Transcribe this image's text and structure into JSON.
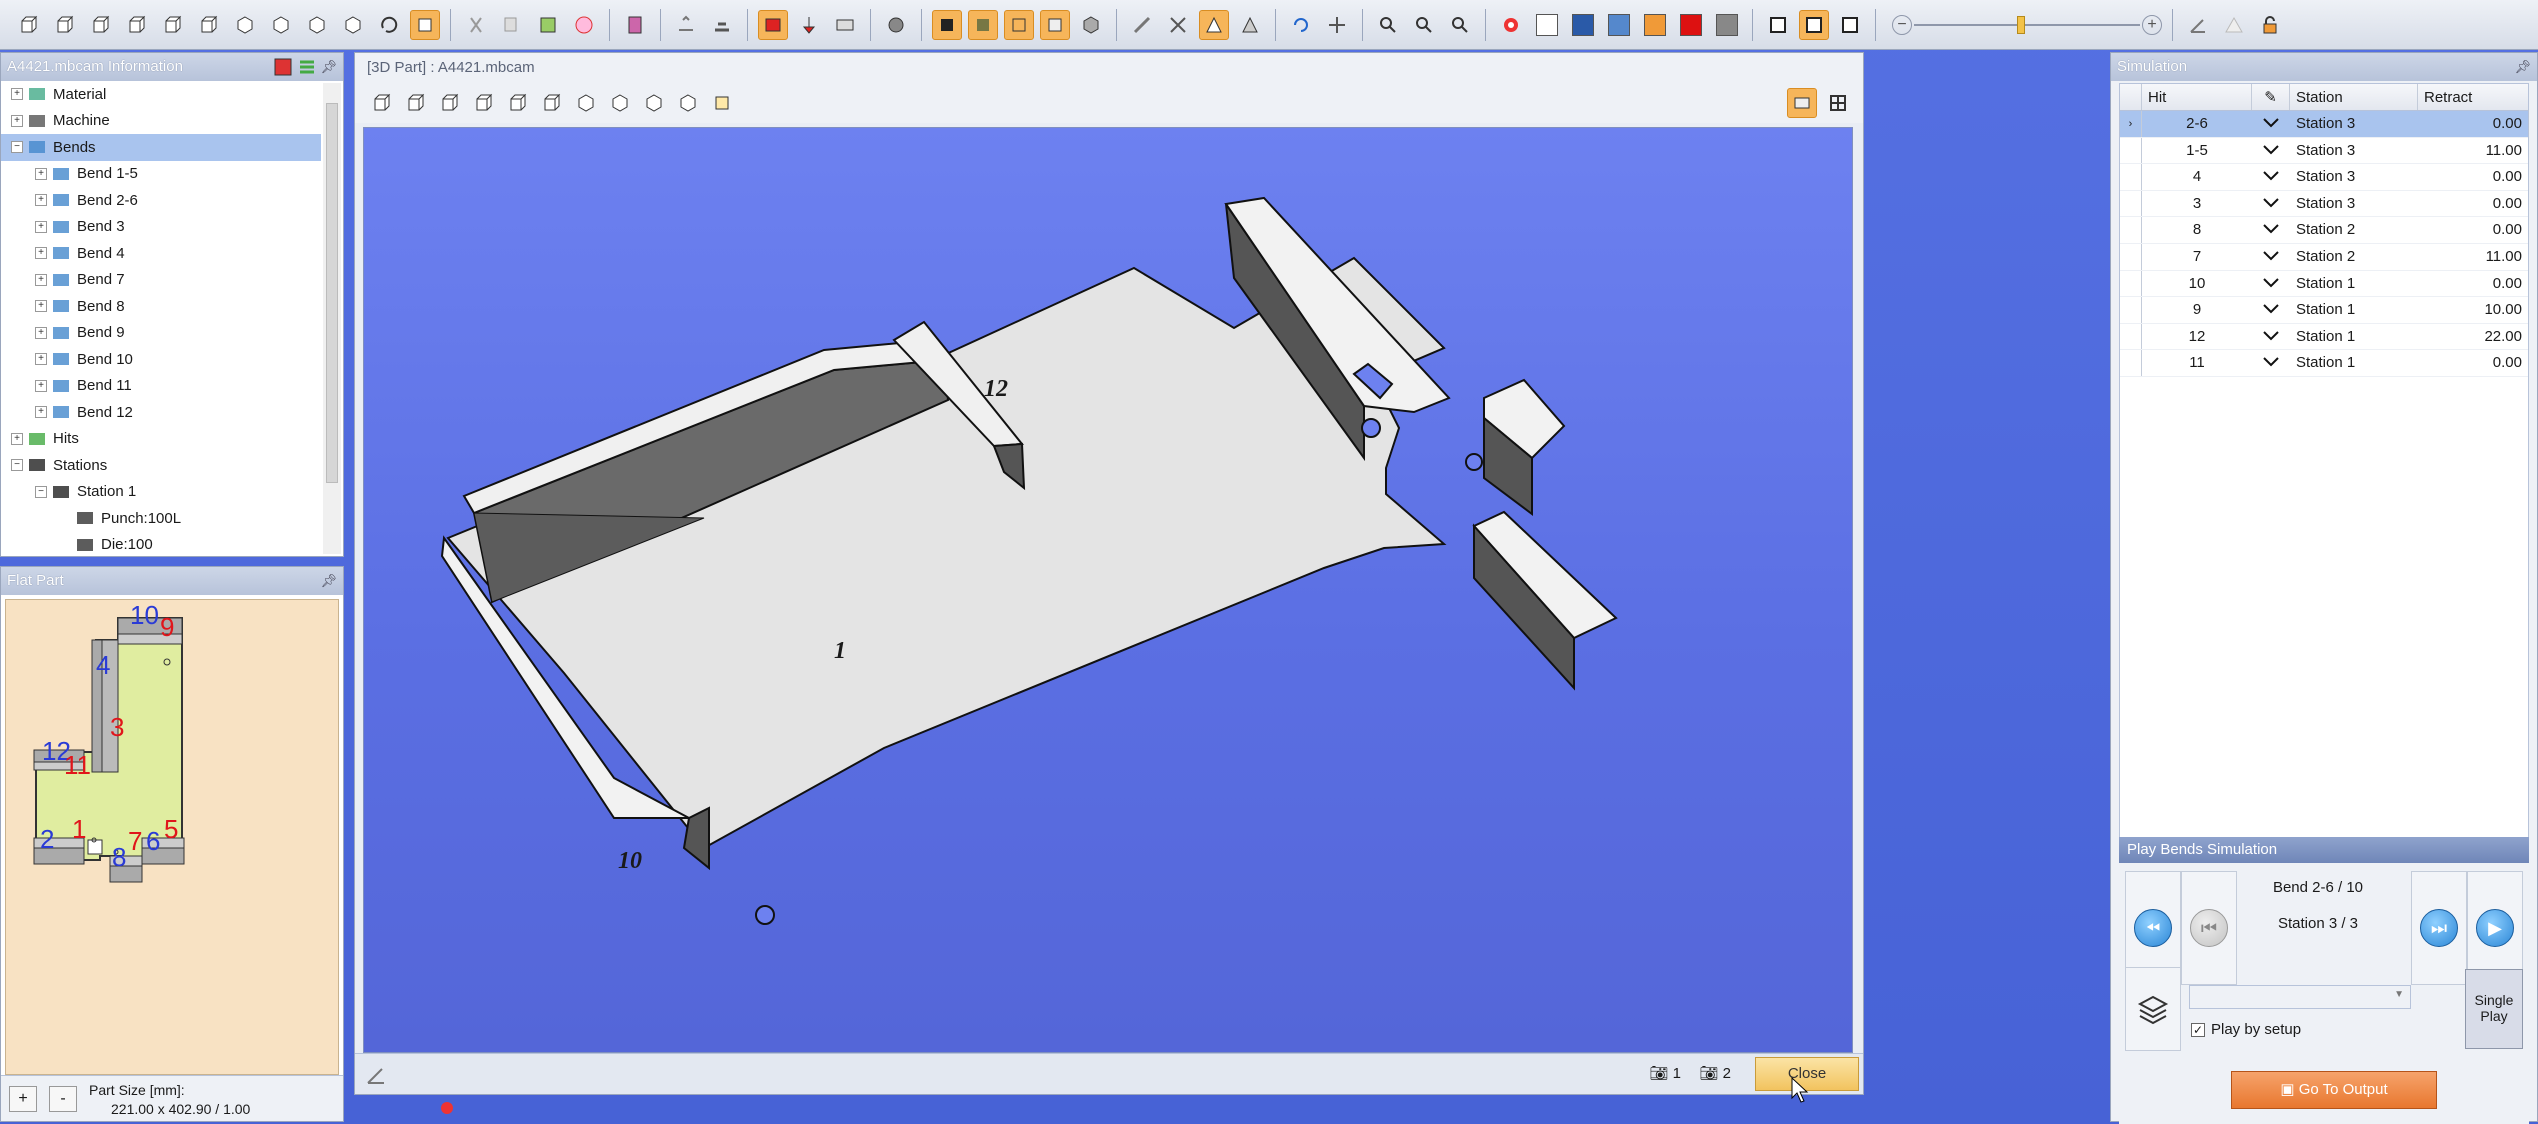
{
  "info_panel": {
    "title": "A4421.mbcam Information",
    "tree": [
      {
        "label": "Material",
        "level": 0,
        "icon": "material-icon",
        "expander": "+"
      },
      {
        "label": "Machine",
        "level": 0,
        "icon": "machine-icon",
        "expander": "+"
      },
      {
        "label": "Bends",
        "level": 0,
        "icon": "bends-icon",
        "expander": "−",
        "selected": true
      },
      {
        "label": "Bend 1-5",
        "level": 1,
        "icon": "bend-icon",
        "expander": "+"
      },
      {
        "label": "Bend 2-6",
        "level": 1,
        "icon": "bend-icon",
        "expander": "+"
      },
      {
        "label": "Bend 3",
        "level": 1,
        "icon": "bend-icon",
        "expander": "+"
      },
      {
        "label": "Bend 4",
        "level": 1,
        "icon": "bend-icon",
        "expander": "+"
      },
      {
        "label": "Bend 7",
        "level": 1,
        "icon": "bend-icon",
        "expander": "+"
      },
      {
        "label": "Bend 8",
        "level": 1,
        "icon": "bend-icon",
        "expander": "+"
      },
      {
        "label": "Bend 9",
        "level": 1,
        "icon": "bend-icon",
        "expander": "+"
      },
      {
        "label": "Bend 10",
        "level": 1,
        "icon": "bend-icon",
        "expander": "+"
      },
      {
        "label": "Bend 11",
        "level": 1,
        "icon": "bend-icon",
        "expander": "+"
      },
      {
        "label": "Bend 12",
        "level": 1,
        "icon": "bend-icon",
        "expander": "+"
      },
      {
        "label": "Hits",
        "level": 0,
        "icon": "hits-icon",
        "expander": "+"
      },
      {
        "label": "Stations",
        "level": 0,
        "icon": "stations-icon",
        "expander": "−"
      },
      {
        "label": "Station 1",
        "level": 1,
        "icon": "station-icon",
        "expander": "−"
      },
      {
        "label": "Punch:100L",
        "level": 2,
        "icon": "punch-icon",
        "expander": ""
      },
      {
        "label": "Die:100",
        "level": 2,
        "icon": "die-icon",
        "expander": ""
      }
    ]
  },
  "flat_panel": {
    "title": "Flat Part",
    "zoom_in_label": "+",
    "zoom_out_label": "-",
    "part_size_label": "Part Size [mm]:",
    "part_size_value": "221.00 x 402.90 / 1.00",
    "labels_blue": [
      "10",
      "4",
      "12",
      "2",
      "6",
      "8"
    ],
    "labels_red": [
      "9",
      "3",
      "11",
      "1",
      "5",
      "7"
    ]
  },
  "view_panel": {
    "title": "[3D Part] : A4421.mbcam",
    "part_labels": [
      "12",
      "1",
      "10"
    ],
    "camera1_label": "1",
    "camera2_label": "2",
    "close_label": "Close"
  },
  "simulation": {
    "title": "Simulation",
    "columns": [
      "Hit",
      "Station",
      "Retract"
    ],
    "rows": [
      {
        "hit": "2-6",
        "station": "Station 3",
        "retract": "0.00",
        "selected": true
      },
      {
        "hit": "1-5",
        "station": "Station 3",
        "retract": "11.00"
      },
      {
        "hit": "4",
        "station": "Station 3",
        "retract": "0.00"
      },
      {
        "hit": "3",
        "station": "Station 3",
        "retract": "0.00"
      },
      {
        "hit": "8",
        "station": "Station 2",
        "retract": "0.00"
      },
      {
        "hit": "7",
        "station": "Station 2",
        "retract": "11.00"
      },
      {
        "hit": "10",
        "station": "Station 1",
        "retract": "0.00"
      },
      {
        "hit": "9",
        "station": "Station 1",
        "retract": "10.00"
      },
      {
        "hit": "12",
        "station": "Station 1",
        "retract": "22.00"
      },
      {
        "hit": "11",
        "station": "Station 1",
        "retract": "0.00"
      }
    ],
    "play_title": "Play Bends Simulation",
    "bend_progress": "Bend 2-6  / 10",
    "station_progress": "Station 3 / 3",
    "play_by_setup_label": "Play by setup",
    "single_play_label": "Single Play",
    "go_to_output_label": "Go To Output"
  },
  "colors": {
    "accent_orange": "#f6b55a",
    "selection_blue": "#a9c4ee",
    "viewport_blue": "#6d81f0",
    "flat_part_fill": "#e0eda0",
    "blue_label": "#2a3bd6",
    "red_label": "#e0161b"
  }
}
